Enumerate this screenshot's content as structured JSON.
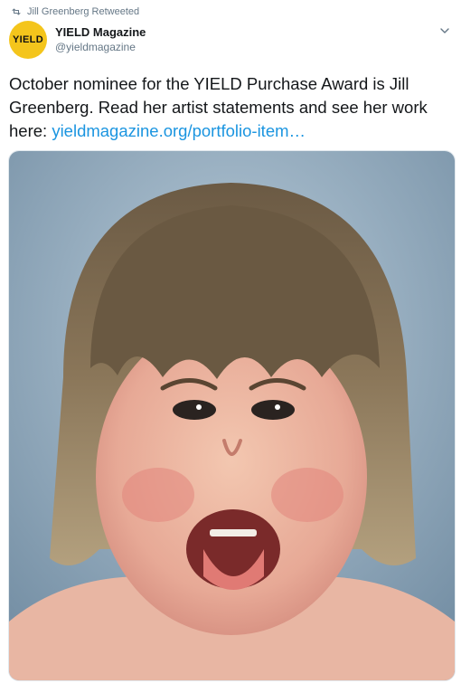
{
  "retweet": {
    "text": "Jill Greenberg Retweeted",
    "icon": "retweet-icon"
  },
  "author": {
    "avatar_text": "YIELD",
    "display_name": "YIELD Magazine",
    "handle": "@yieldmagazine",
    "avatar_color": "#f4c51c"
  },
  "tweet": {
    "text": "October nominee for the YIELD Purchase Award is Jill Greenberg. Read her artist statements and see her work here: ",
    "link": "yieldmagazine.org/portfolio-item…"
  },
  "colors": {
    "link": "#1b95e0",
    "muted": "#657786",
    "text": "#14171a"
  }
}
